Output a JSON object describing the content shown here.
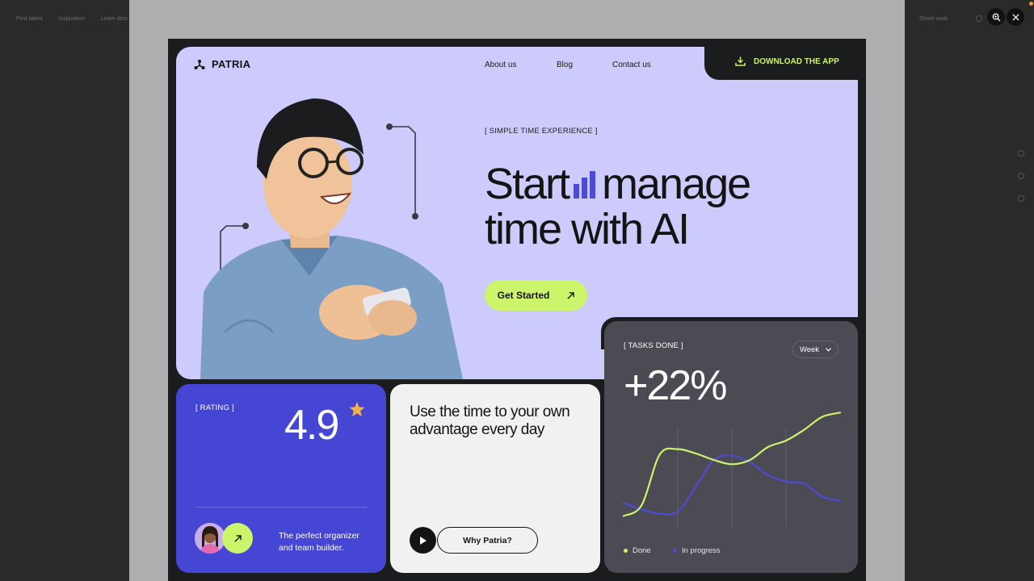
{
  "background": {
    "nav": [
      "Find talent",
      "Inspiration",
      "Learn desi"
    ],
    "share": "Share work"
  },
  "viewer": {
    "zoom_icon": "zoom-icon",
    "close_icon": "close-icon"
  },
  "header": {
    "brand": "PATRIA",
    "nav": [
      "About us",
      "Blog",
      "Contact us"
    ],
    "download": "DOWNLOAD THE APP"
  },
  "hero": {
    "tag": "[ SIMPLE TIME EXPERIENCE ]",
    "headline_start": "Start",
    "headline_mid": "manage",
    "headline_line2": "time with AI",
    "cta": "Get Started"
  },
  "rating": {
    "tag": "[ RATING ]",
    "value": "4.9",
    "text": "The perfect organizer and team builder."
  },
  "feature": {
    "title": "Use the time to your own advantage every day",
    "button": "Why Patria?"
  },
  "tasks": {
    "tag": "[ TASKS DONE ]",
    "period": "Week",
    "value": "+22%"
  },
  "chart_data": {
    "type": "line",
    "x": [
      0,
      1,
      2,
      3,
      4,
      5,
      6,
      7,
      8,
      9,
      10,
      11,
      12
    ],
    "series": [
      {
        "name": "Done",
        "values": [
          8,
          18,
          65,
          70,
          66,
          60,
          56,
          60,
          72,
          78,
          88,
          100,
          104
        ]
      },
      {
        "name": "In progress",
        "values": [
          20,
          14,
          10,
          12,
          35,
          60,
          64,
          58,
          46,
          40,
          38,
          26,
          22
        ]
      }
    ],
    "colors": {
      "Done": "#cdf56c",
      "In progress": "#4b4bd6"
    },
    "ylim": [
      0,
      120
    ],
    "grid": true,
    "legend": "bottom-left"
  },
  "colors": {
    "hero_bg": "#cccbfb",
    "accent_lime": "#cdf56c",
    "accent_indigo": "#4646d4",
    "dark": "#1b1c1e",
    "card_dark": "#4c4b54",
    "star": "#f4b04a"
  }
}
